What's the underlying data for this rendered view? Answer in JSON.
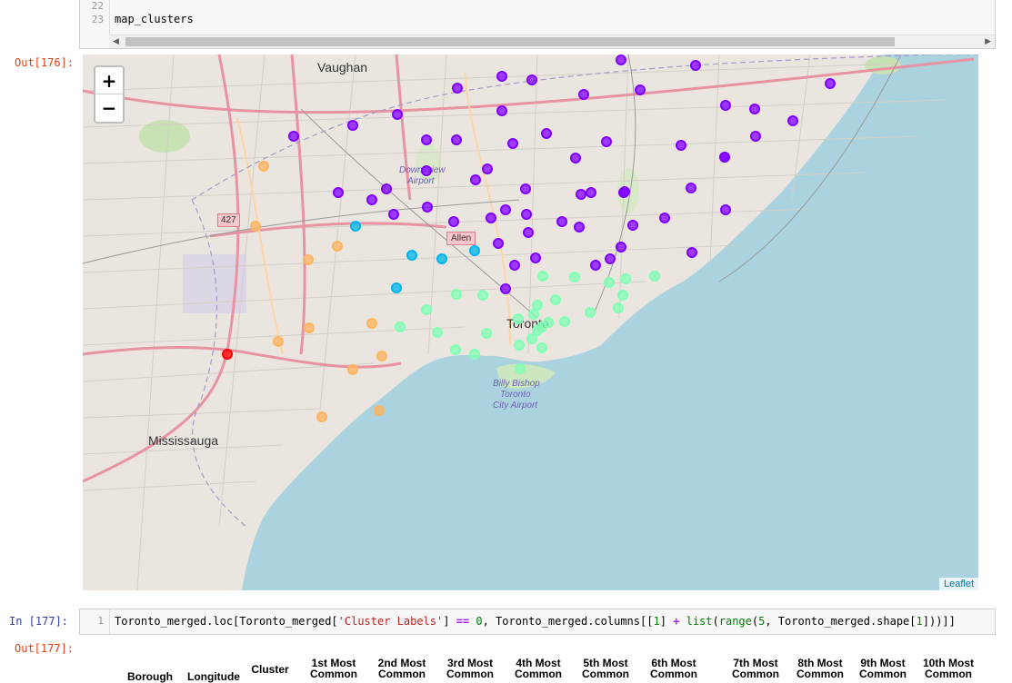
{
  "top_cell": {
    "line_numbers": [
      "22",
      "23"
    ],
    "code_line": "map_clusters"
  },
  "out_prompt_1": "Out[176]:",
  "map": {
    "zoom_in": "+",
    "zoom_out": "−",
    "attribution": "Leaflet",
    "labels": {
      "vaughan": "Vaughan",
      "mississauga": "Mississauga",
      "toronto": "Toronto",
      "downsview": "Downsview",
      "airport": "Airport",
      "allen": "Allen",
      "billy1": "Billy Bishop",
      "billy2": "Toronto",
      "billy3": "City Airport",
      "hwy427": "427"
    },
    "colors": {
      "cluster0": "#ff0000",
      "cluster1": "#8000ff",
      "cluster2": "#00b5eb",
      "cluster3": "#80ffb4",
      "cluster4": "#ffb360",
      "water": "#aad3df",
      "land": "#eae6df"
    }
  },
  "in_prompt_2": "In  [177]:",
  "bottom_cell": {
    "line_number": "1",
    "code": {
      "p1": "Toronto_merged.loc[Toronto_merged[",
      "s1": "'Cluster Labels'",
      "p2": "] ",
      "op1": "==",
      "p3": " ",
      "num0": "0",
      "p4": ", Toronto_merged.columns[[",
      "num1": "1",
      "p5": "] ",
      "op2": "+",
      "p6": " ",
      "fn1": "list",
      "p7": "(",
      "fn2": "range",
      "p8": "(",
      "num5": "5",
      "p9": ", Toronto_merged.shape[",
      "num1b": "1",
      "p10": "]))]]"
    }
  },
  "out_prompt_2": "Out[177]:",
  "table_headers": {
    "borough": "Borough",
    "longitude": "Longitude",
    "cluster": "Cluster",
    "c1": "1st Most",
    "c2": "2nd Most",
    "c3": "3rd Most",
    "c4": "4th Most",
    "c5": "5th Most",
    "c6": "6th Most",
    "c7": "7th Most",
    "c8": "8th Most",
    "c9": "9th Most",
    "c10": "10th Most",
    "common": "Common"
  }
}
